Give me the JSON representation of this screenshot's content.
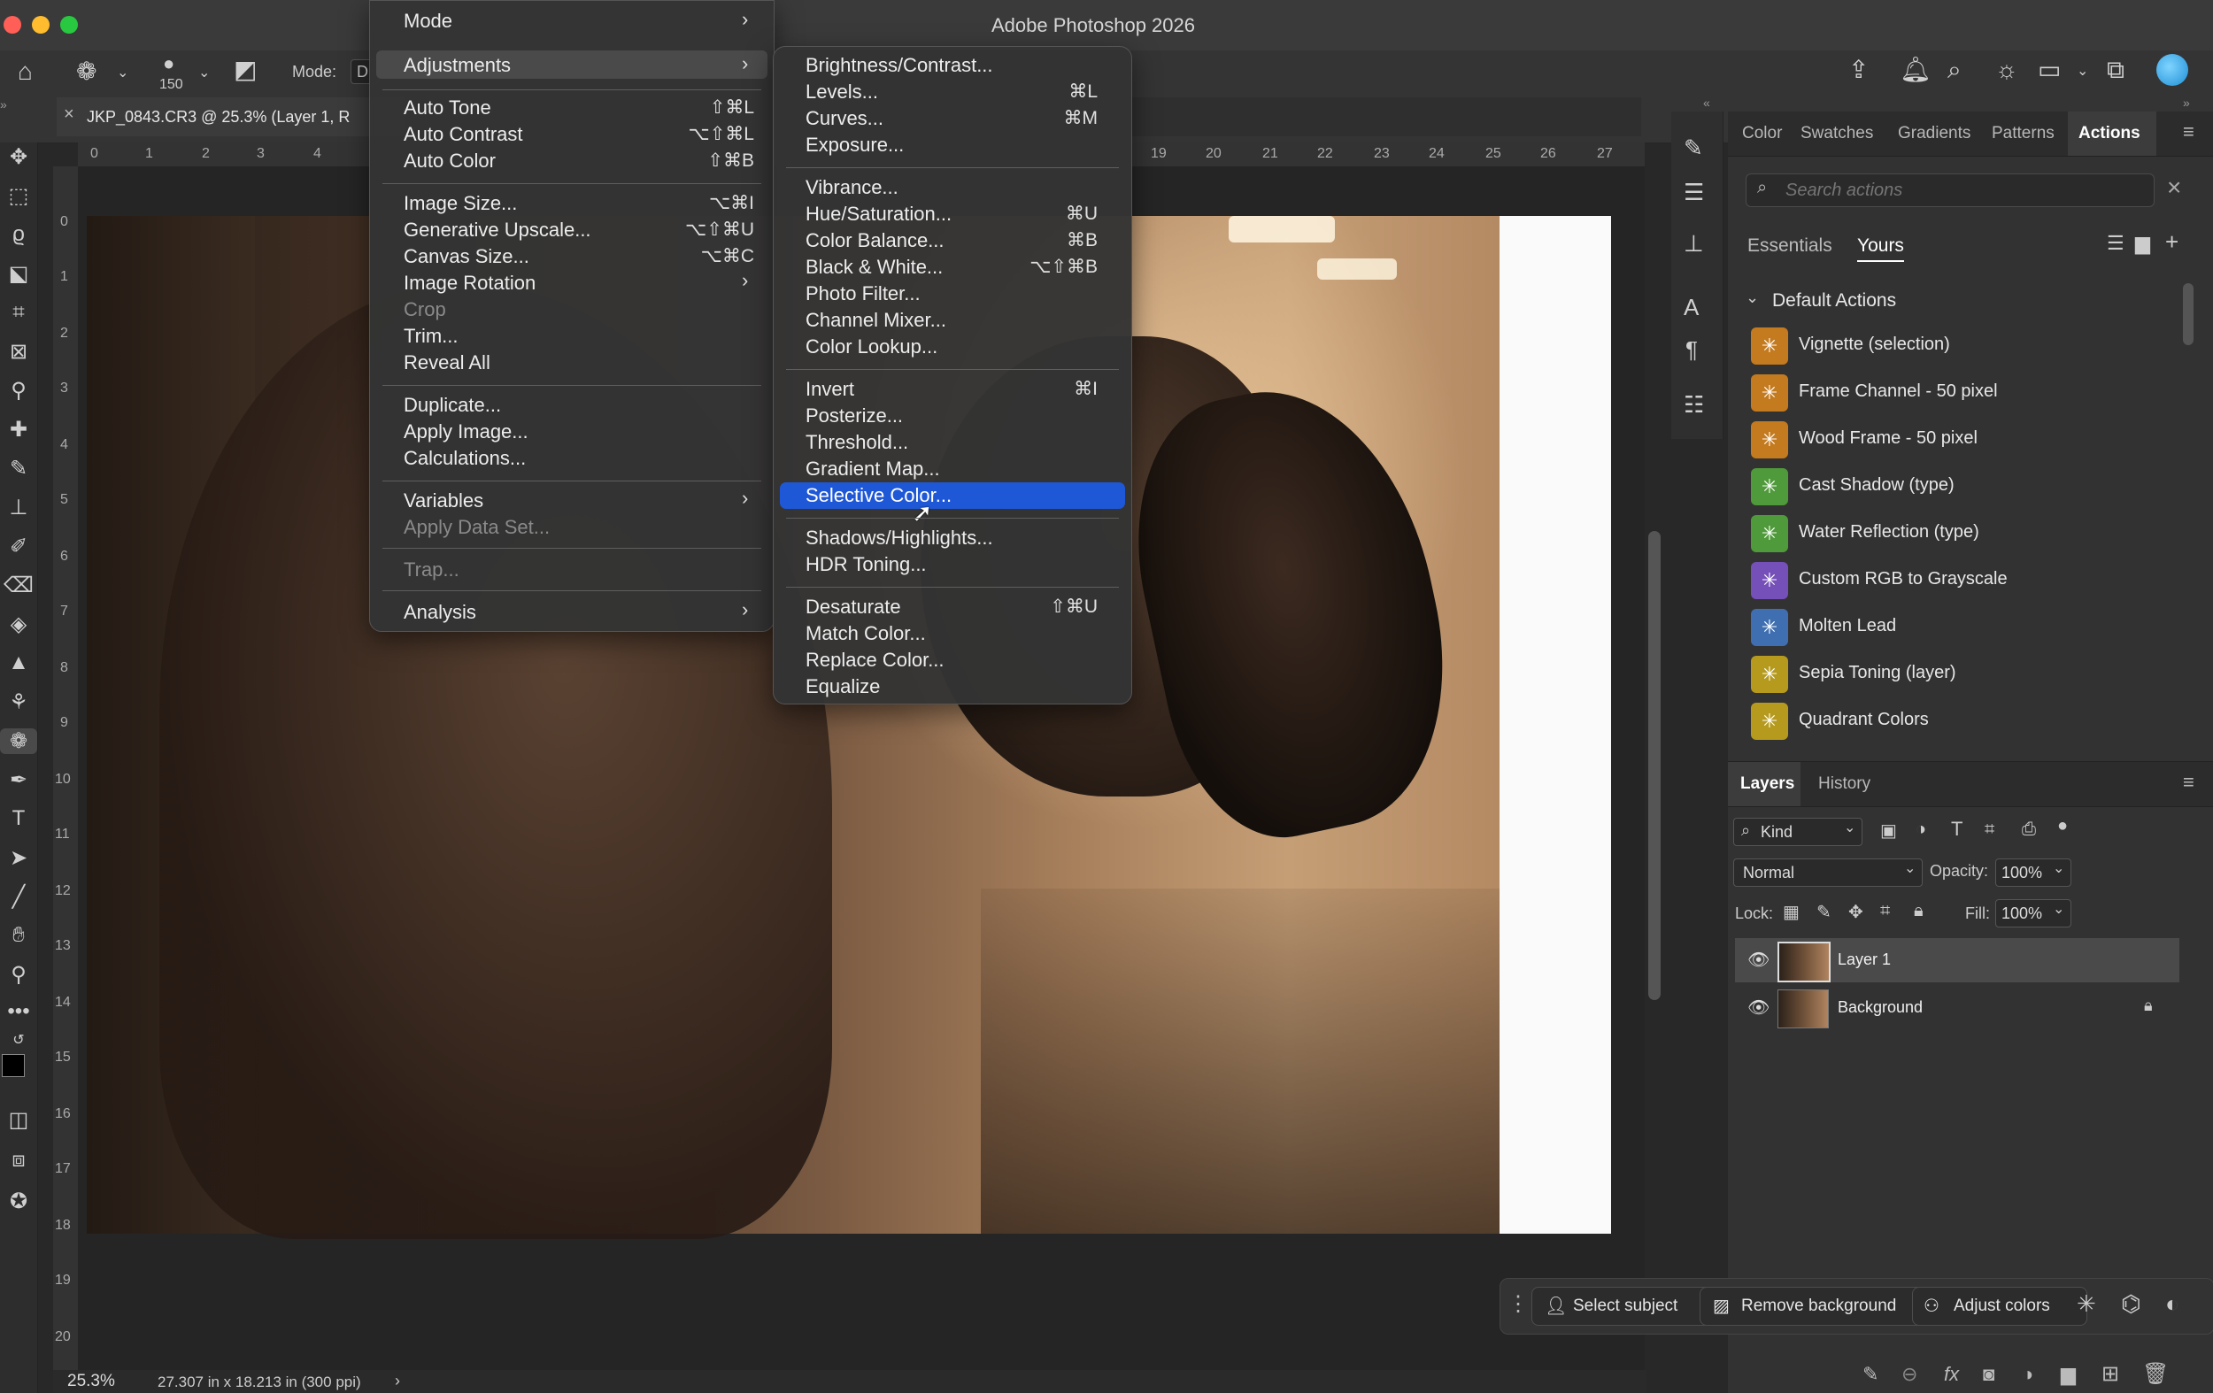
{
  "app": {
    "title": "Adobe Photoshop 2026"
  },
  "options_bar": {
    "brush_size": "150",
    "mode_label": "Mode:",
    "mode_value": "D"
  },
  "document": {
    "tab_title": "JKP_0843.CR3 @ 25.3% (Layer 1, R",
    "zoom": "25.3%",
    "dimensions": "27.307 in x 18.213 in (300 ppi)"
  },
  "rulers": {
    "top_left": [
      "0",
      "1",
      "2",
      "3",
      "4"
    ],
    "top_right": [
      "19",
      "20",
      "21",
      "22",
      "23",
      "24",
      "25",
      "26",
      "27"
    ],
    "left": [
      "0",
      "1",
      "2",
      "3",
      "4",
      "5",
      "6",
      "7",
      "8",
      "9",
      "10",
      "11",
      "12",
      "13",
      "14",
      "15",
      "16",
      "17",
      "18",
      "19",
      "20"
    ]
  },
  "image_menu": {
    "items": [
      {
        "label": "Mode",
        "submenu": true
      },
      {
        "label": "Adjustments",
        "submenu": true,
        "highlighted": true
      },
      {
        "label": "Auto Tone",
        "shortcut": "⇧⌘L"
      },
      {
        "label": "Auto Contrast",
        "shortcut": "⌥⇧⌘L"
      },
      {
        "label": "Auto Color",
        "shortcut": "⇧⌘B"
      },
      {
        "label": "Image Size...",
        "shortcut": "⌥⌘I"
      },
      {
        "label": "Generative Upscale...",
        "shortcut": "⌥⇧⌘U"
      },
      {
        "label": "Canvas Size...",
        "shortcut": "⌥⌘C"
      },
      {
        "label": "Image Rotation",
        "submenu": true
      },
      {
        "label": "Crop",
        "disabled": true
      },
      {
        "label": "Trim..."
      },
      {
        "label": "Reveal All"
      },
      {
        "label": "Duplicate..."
      },
      {
        "label": "Apply Image..."
      },
      {
        "label": "Calculations..."
      },
      {
        "label": "Variables",
        "submenu": true
      },
      {
        "label": "Apply Data Set...",
        "disabled": true
      },
      {
        "label": "Trap...",
        "disabled": true
      },
      {
        "label": "Analysis",
        "submenu": true
      }
    ]
  },
  "adjustments_menu": {
    "items": [
      {
        "label": "Brightness/Contrast..."
      },
      {
        "label": "Levels...",
        "shortcut": "⌘L"
      },
      {
        "label": "Curves...",
        "shortcut": "⌘M"
      },
      {
        "label": "Exposure..."
      },
      {
        "label": "Vibrance..."
      },
      {
        "label": "Hue/Saturation...",
        "shortcut": "⌘U"
      },
      {
        "label": "Color Balance...",
        "shortcut": "⌘B"
      },
      {
        "label": "Black & White...",
        "shortcut": "⌥⇧⌘B"
      },
      {
        "label": "Photo Filter..."
      },
      {
        "label": "Channel Mixer..."
      },
      {
        "label": "Color Lookup..."
      },
      {
        "label": "Invert",
        "shortcut": "⌘I"
      },
      {
        "label": "Posterize..."
      },
      {
        "label": "Threshold..."
      },
      {
        "label": "Gradient Map..."
      },
      {
        "label": "Selective Color...",
        "selected": true
      },
      {
        "label": "Shadows/Highlights..."
      },
      {
        "label": "HDR Toning..."
      },
      {
        "label": "Desaturate",
        "shortcut": "⇧⌘U"
      },
      {
        "label": "Match Color..."
      },
      {
        "label": "Replace Color..."
      },
      {
        "label": "Equalize"
      }
    ]
  },
  "top_panel": {
    "tabs": [
      "Color",
      "Swatches",
      "Gradients",
      "Patterns",
      "Actions"
    ],
    "active_tab": "Actions",
    "search_placeholder": "Search actions",
    "subtabs": [
      "Essentials",
      "Yours"
    ],
    "group": "Default Actions",
    "actions": [
      {
        "label": "Vignette (selection)",
        "color": "#c47a1e"
      },
      {
        "label": "Frame Channel - 50 pixel",
        "color": "#c47a1e"
      },
      {
        "label": "Wood Frame - 50 pixel",
        "color": "#c47a1e"
      },
      {
        "label": "Cast Shadow (type)",
        "color": "#4f9a3a"
      },
      {
        "label": "Water Reflection (type)",
        "color": "#4f9a3a"
      },
      {
        "label": "Custom RGB to Grayscale",
        "color": "#7550b8"
      },
      {
        "label": "Molten Lead",
        "color": "#3f6fb0"
      },
      {
        "label": "Sepia Toning (layer)",
        "color": "#b59a1e"
      },
      {
        "label": "Quadrant Colors",
        "color": "#b59a1e"
      }
    ]
  },
  "layers_panel": {
    "tabs": [
      "Layers",
      "History"
    ],
    "kind_label": "Kind",
    "blend_mode": "Normal",
    "opacity_label": "Opacity:",
    "opacity_value": "100%",
    "lock_label": "Lock:",
    "fill_label": "Fill:",
    "fill_value": "100%",
    "layers": [
      {
        "name": "Layer 1",
        "selected": true
      },
      {
        "name": "Background",
        "locked": true
      }
    ]
  },
  "context_bar": {
    "select_subject": "Select subject",
    "remove_background": "Remove background",
    "adjust_colors": "Adjust colors"
  }
}
